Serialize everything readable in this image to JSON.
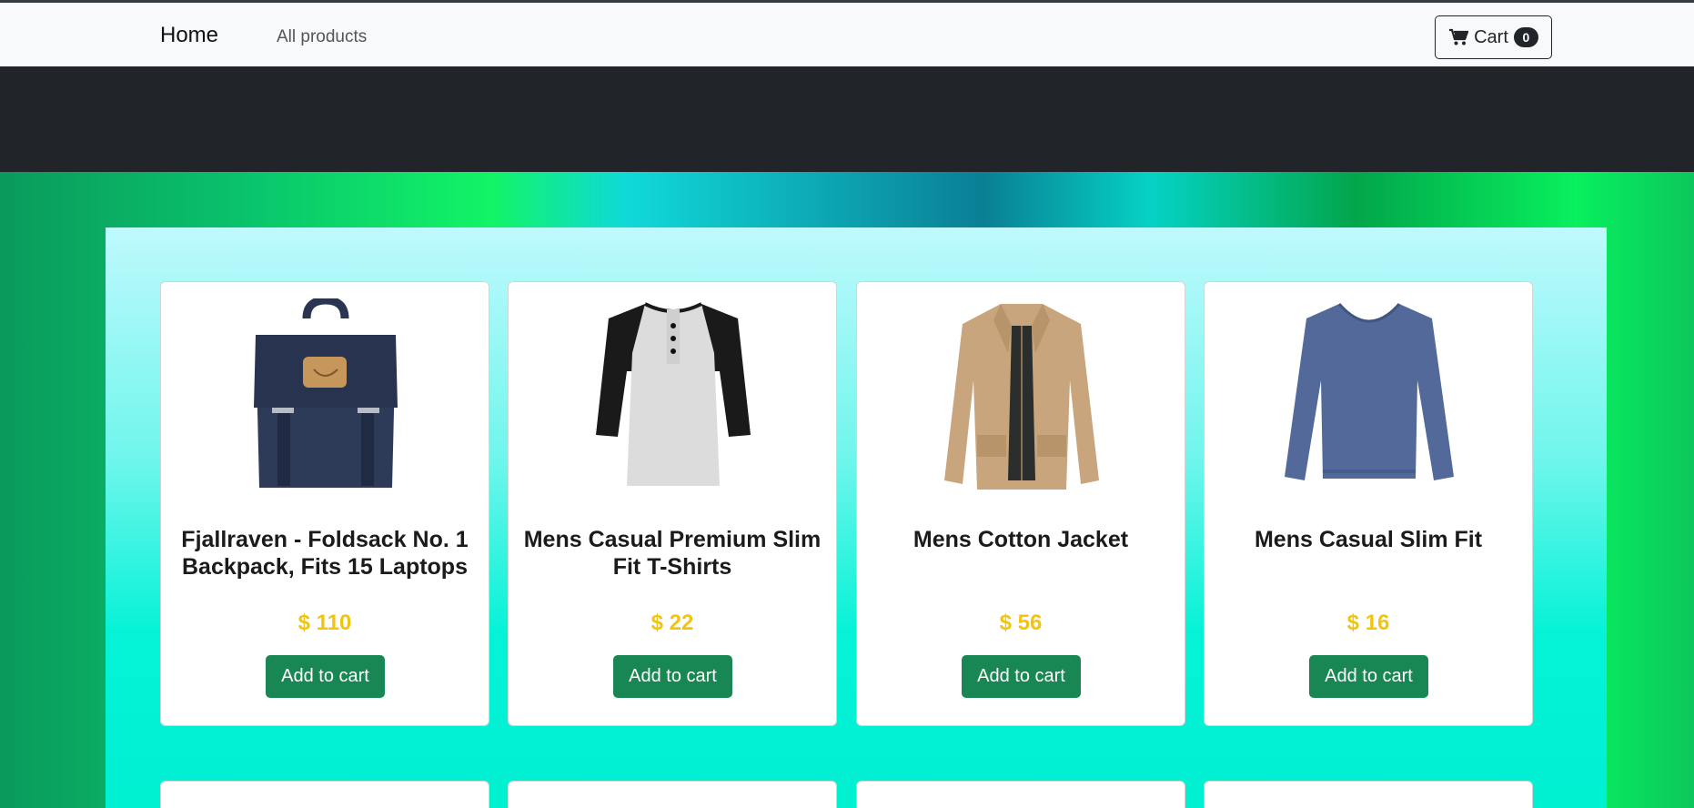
{
  "navbar": {
    "brand": "Home",
    "link": "All products",
    "cart_label": "Cart",
    "cart_count": "0"
  },
  "products": [
    {
      "title": "Fjallraven - Foldsack No. 1 Backpack, Fits 15 Laptops",
      "price": "$ 110",
      "button": "Add to cart",
      "image": "navy-backpack"
    },
    {
      "title": "Mens Casual Premium Slim Fit T-Shirts",
      "price": "$ 22",
      "button": "Add to cart",
      "image": "raglan-tshirt"
    },
    {
      "title": "Mens Cotton Jacket",
      "price": "$ 56",
      "button": "Add to cart",
      "image": "khaki-jacket"
    },
    {
      "title": "Mens Casual Slim Fit",
      "price": "$ 16",
      "button": "Add to cart",
      "image": "blue-longsleeve"
    }
  ],
  "colors": {
    "navbar_bg": "#f8f9fa",
    "hero_bg": "#212529",
    "price": "#f2c40f",
    "button": "#198754"
  }
}
